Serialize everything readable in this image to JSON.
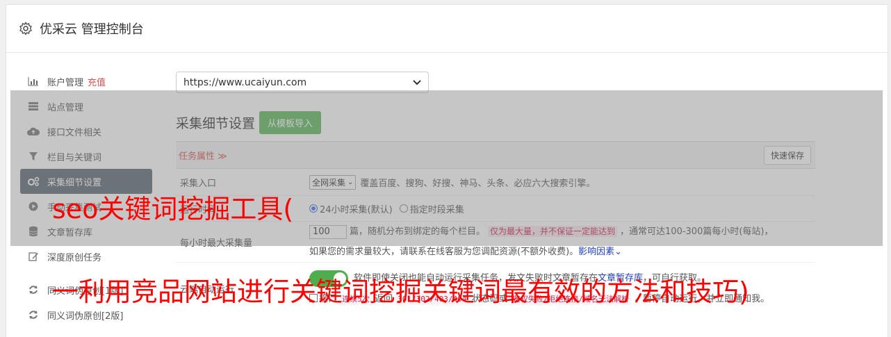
{
  "header": {
    "title": "优采云 管理控制台"
  },
  "sidebar": {
    "items": [
      {
        "label": "账户管理",
        "extra": "充值",
        "icon": "bar-chart-icon"
      },
      {
        "label": "站点管理",
        "icon": "server-icon"
      },
      {
        "label": "接口文件相关",
        "icon": "cloud-upload-icon"
      },
      {
        "label": "栏目与关键词",
        "icon": "filter-icon"
      },
      {
        "label": "采集细节设置",
        "icon": "gears-icon",
        "active": true
      },
      {
        "label": "手动采集测试",
        "icon": "play-circle-icon"
      },
      {
        "label": "文章暂存库",
        "icon": "database-icon"
      },
      {
        "label": "深度原创任务",
        "icon": "edit-icon"
      },
      {
        "label": "同义词伪原创[1版]",
        "icon": "refresh-icon"
      },
      {
        "label": "同义词伪原创[2版]",
        "icon": "refresh-icon"
      }
    ]
  },
  "main": {
    "site_url": "https://www.ucaiyun.com",
    "section_title": "采集细节设置",
    "template_button": "从模板导入",
    "task_props": "任务属性 ≫",
    "quick_save": "快速保存",
    "rows": {
      "entry": {
        "label": "采集入口",
        "select": "全网采集",
        "desc": "覆盖百度、搜狗、好搜、神马、头条、必应六大搜索引擎。"
      },
      "time": {
        "label": "运行时间",
        "opt1": "24小时采集(默认)",
        "opt2": "指定时段采集"
      },
      "max": {
        "label": "每小时最大采集量",
        "value": "100",
        "t1": "篇，随机分布到绑定的每个栏目。",
        "hint": "仅为最大量，并不保证一定能达到",
        "t2": "，通常可达100-300篇每小时(每站)，",
        "t3": "如果您的需求量较大，请联系在线客服为您调配资源(不额外收费)。",
        "link": "影响因素"
      },
      "cloud": {
        "label": "云端自动运行",
        "t1": "软件即使关闭也能自动运行采集任务，发文失败时文章暂存在",
        "link": "文章暂存库",
        "t2": "，可自行获取。",
        "cb_label": "接口",
        "code1": "连续5次",
        "t3": "返回",
        "code2": "301/302/403/404",
        "t4": "状态码或",
        "code3": "鉴权失败/拒绝连接/域名无法解析",
        "t5": "，暂停自动运行，并立即通知我。"
      }
    }
  },
  "overlay": {
    "line1": "seo关键词挖掘工具(",
    "line2": "一利用竞品网站进行关键词挖掘关键词最有效的方法和技巧)"
  },
  "colors": {
    "accent_red": "#ff0000",
    "green": "#5cb85c",
    "active_nav": "#5a6672"
  }
}
